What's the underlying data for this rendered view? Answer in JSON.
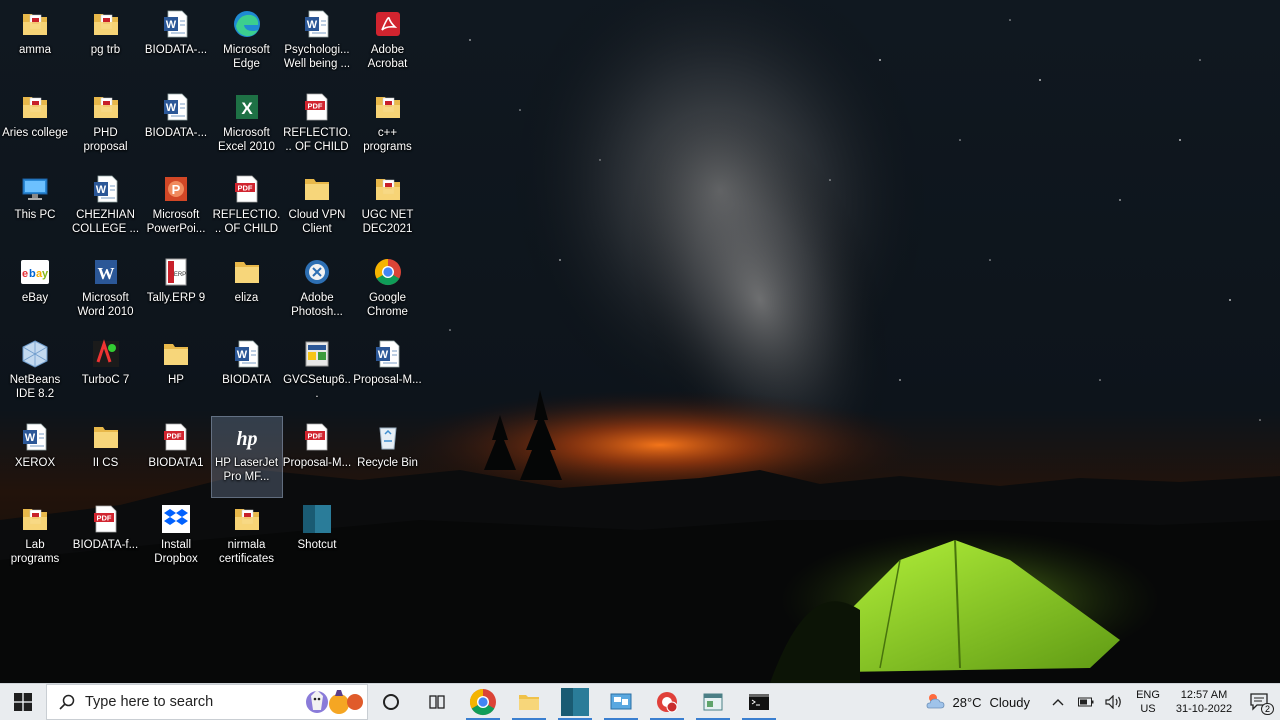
{
  "desktop": {
    "icons": [
      {
        "label": "amma",
        "icon": "folder-pdf-icon"
      },
      {
        "label": "pg trb",
        "icon": "folder-pdf-icon"
      },
      {
        "label": "BIODATA-...",
        "icon": "word-doc-icon"
      },
      {
        "label": "Microsoft Edge",
        "icon": "edge-icon"
      },
      {
        "label": "Psychologi... Well being ...",
        "icon": "word-doc-icon"
      },
      {
        "label": "Adobe Acrobat",
        "icon": "acrobat-icon"
      },
      {
        "label": "Aries college",
        "icon": "folder-pdf-icon"
      },
      {
        "label": "PHD proposal",
        "icon": "folder-pdf-icon"
      },
      {
        "label": "BIODATA-...",
        "icon": "word-doc-icon"
      },
      {
        "label": "Microsoft Excel 2010",
        "icon": "excel-icon"
      },
      {
        "label": "REFLECTIO... OF CHILD ...",
        "icon": "pdf-file-icon"
      },
      {
        "label": "c++ programs",
        "icon": "folder-pdf-icon"
      },
      {
        "label": "This PC",
        "icon": "this-pc-icon"
      },
      {
        "label": "CHEZHIAN COLLEGE ...",
        "icon": "word-doc-icon"
      },
      {
        "label": "Microsoft PowerPoi...",
        "icon": "powerpoint-icon"
      },
      {
        "label": "REFLECTIO... OF CHILD ...",
        "icon": "pdf-file-icon"
      },
      {
        "label": "Cloud VPN Client",
        "icon": "folder-icon"
      },
      {
        "label": "UGC NET DEC2021",
        "icon": "folder-pdf-icon"
      },
      {
        "label": "eBay",
        "icon": "ebay-icon"
      },
      {
        "label": "Microsoft Word 2010",
        "icon": "word-app-icon"
      },
      {
        "label": "Tally.ERP 9",
        "icon": "tally-icon"
      },
      {
        "label": "eliza",
        "icon": "folder-icon"
      },
      {
        "label": "Adobe Photosh...",
        "icon": "photoshop-icon"
      },
      {
        "label": "Google Chrome",
        "icon": "chrome-icon"
      },
      {
        "label": "NetBeans IDE 8.2",
        "icon": "netbeans-icon"
      },
      {
        "label": "TurboC 7",
        "icon": "turboc-icon"
      },
      {
        "label": "HP",
        "icon": "folder-icon"
      },
      {
        "label": "BIODATA",
        "icon": "word-doc-icon"
      },
      {
        "label": "GVCSetup6...",
        "icon": "setup-icon"
      },
      {
        "label": "Proposal-M...",
        "icon": "word-doc-icon"
      },
      {
        "label": "XEROX",
        "icon": "word-doc-icon"
      },
      {
        "label": "II CS",
        "icon": "folder-icon"
      },
      {
        "label": "BIODATA1",
        "icon": "pdf-file-icon"
      },
      {
        "label": "HP LaserJet Pro MF...",
        "icon": "hp-icon"
      },
      {
        "label": "Proposal-M...",
        "icon": "pdf-file-icon"
      },
      {
        "label": "Recycle Bin",
        "icon": "recycle-bin-icon"
      },
      {
        "label": "Lab programs",
        "icon": "folder-pdf-icon"
      },
      {
        "label": "BIODATA-f...",
        "icon": "pdf-file-icon"
      },
      {
        "label": "Install Dropbox",
        "icon": "dropbox-icon"
      },
      {
        "label": "nirmala certificates",
        "icon": "folder-pdf-icon"
      },
      {
        "label": "Shotcut",
        "icon": "shotcut-icon"
      }
    ]
  },
  "taskbar": {
    "search_placeholder": "Type here to search",
    "pinned": [
      {
        "icon": "cortana-icon",
        "running": false
      },
      {
        "icon": "task-view-icon",
        "running": false
      },
      {
        "icon": "chrome-icon",
        "running": true
      },
      {
        "icon": "file-explorer-icon",
        "running": true
      },
      {
        "icon": "shotcut-icon",
        "running": true
      },
      {
        "icon": "control-panel-icon",
        "running": true
      },
      {
        "icon": "screen-recorder-icon",
        "running": true
      },
      {
        "icon": "window-app-icon",
        "running": true
      },
      {
        "icon": "command-prompt-icon",
        "running": true
      }
    ],
    "weather": {
      "temp": "28°C",
      "condition": "Cloudy"
    },
    "language": {
      "lang": "ENG",
      "region": "US"
    },
    "clock": {
      "time": "12:57 AM",
      "date": "31-10-2022"
    },
    "notifications_count": "2"
  }
}
